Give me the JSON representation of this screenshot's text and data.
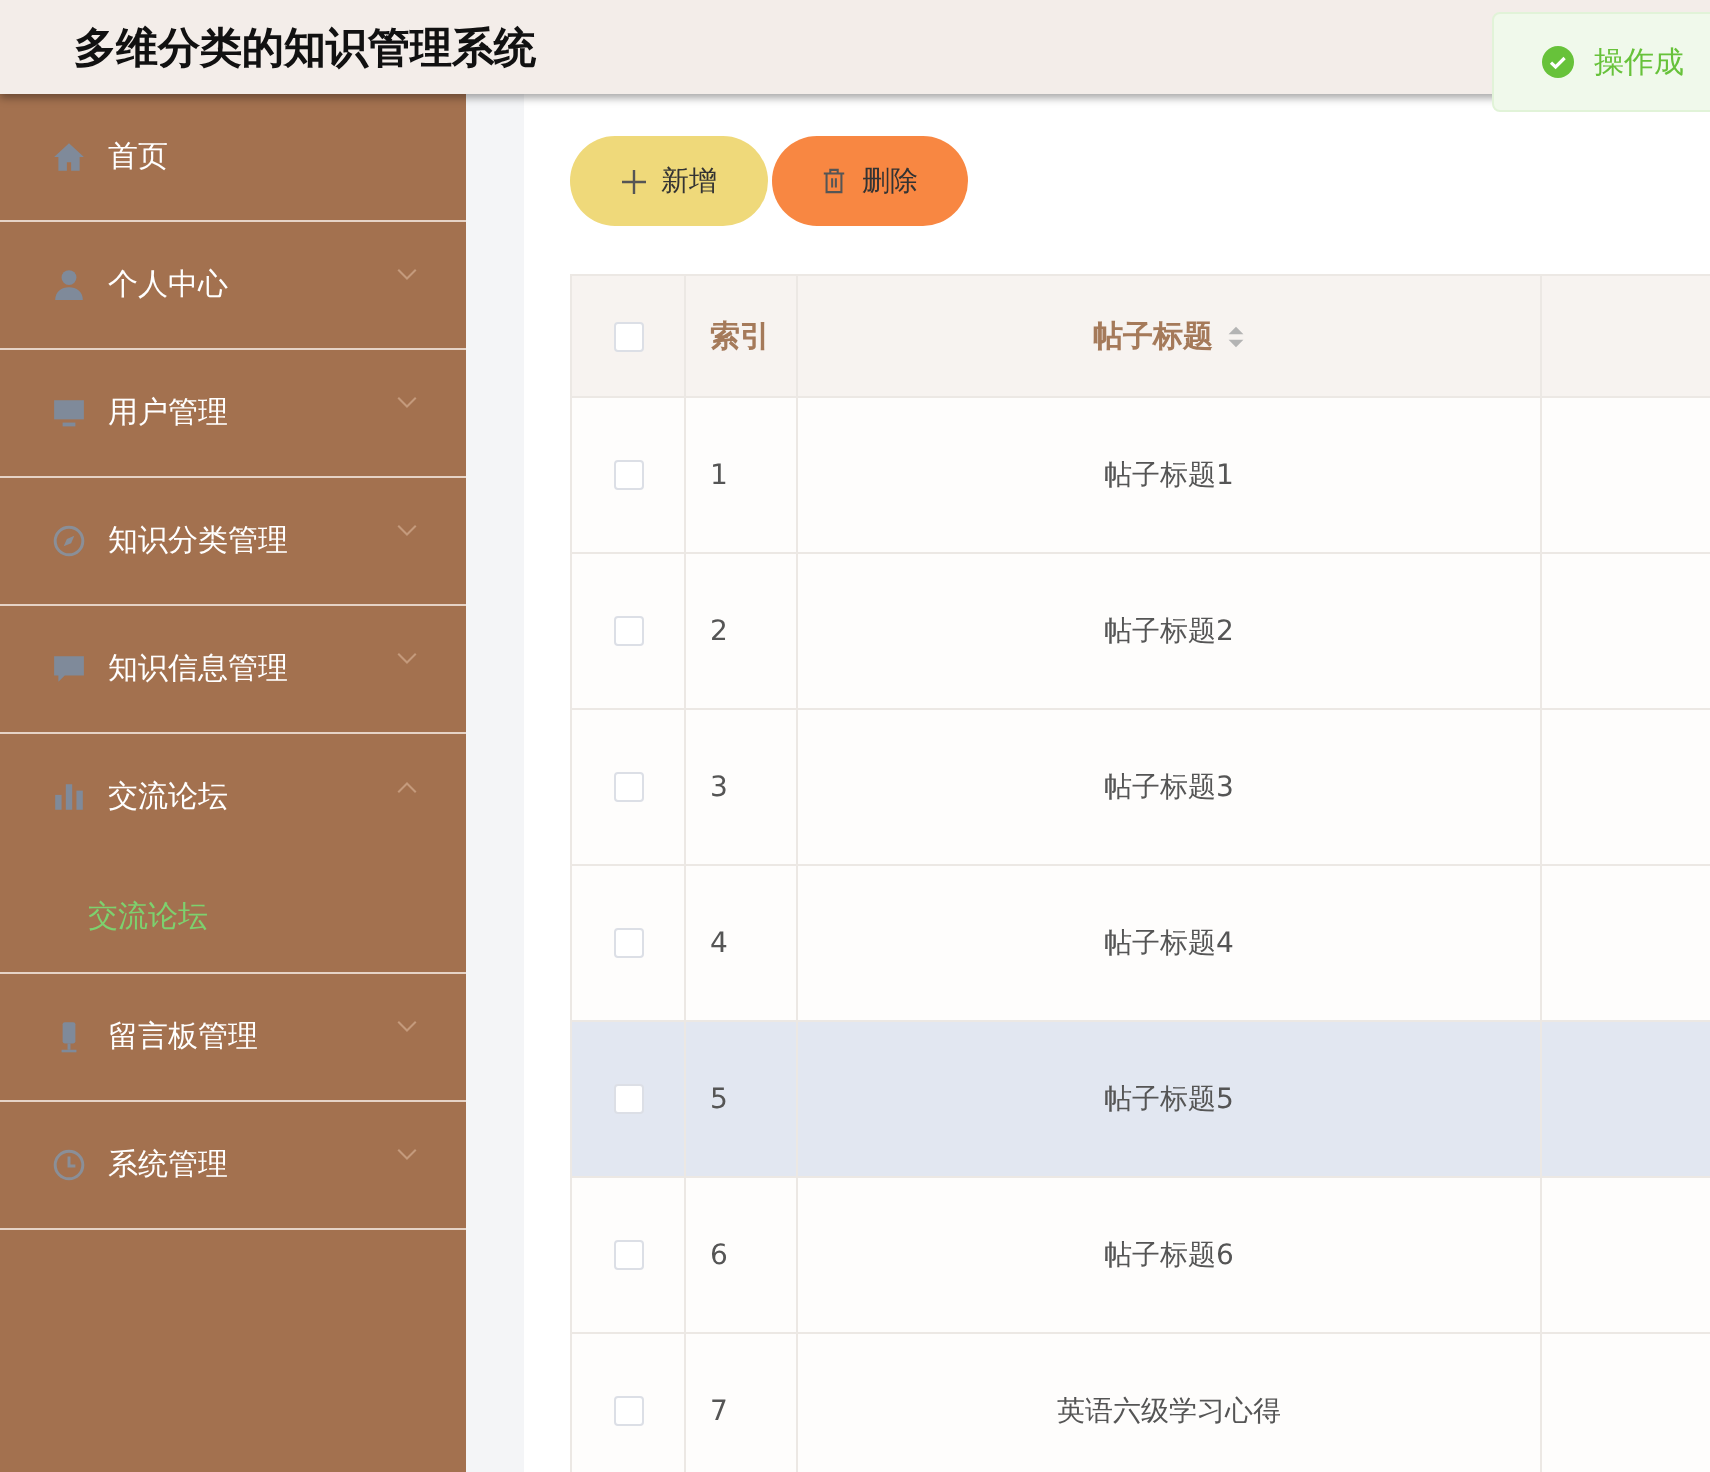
{
  "header": {
    "title": "多维分类的知识管理系统"
  },
  "toast": {
    "kind": "success",
    "text": "操作成"
  },
  "sidebar": {
    "items": [
      {
        "label": "首页"
      },
      {
        "label": "个人中心",
        "expandable": true,
        "expanded": false
      },
      {
        "label": "用户管理",
        "expandable": true,
        "expanded": false
      },
      {
        "label": "知识分类管理",
        "expandable": true,
        "expanded": false
      },
      {
        "label": "知识信息管理",
        "expandable": true,
        "expanded": false
      },
      {
        "label": "交流论坛",
        "expandable": true,
        "expanded": true,
        "children": [
          {
            "label": "交流论坛",
            "selected": true
          }
        ]
      },
      {
        "label": "留言板管理",
        "expandable": true,
        "expanded": false
      },
      {
        "label": "系统管理",
        "expandable": true,
        "expanded": false
      }
    ]
  },
  "toolbar": {
    "buttons": [
      {
        "kind": "add",
        "label": "新增"
      },
      {
        "kind": "delete",
        "label": "删除"
      }
    ]
  },
  "table": {
    "all_checked": false,
    "columns": [
      {
        "label": "索引",
        "sortable": false
      },
      {
        "label": "帖子标题",
        "sortable": true
      }
    ],
    "rows": [
      {
        "index": "1",
        "title": "帖子标题1",
        "checked": false,
        "highlighted": false
      },
      {
        "index": "2",
        "title": "帖子标题2",
        "checked": false,
        "highlighted": false
      },
      {
        "index": "3",
        "title": "帖子标题3",
        "checked": false,
        "highlighted": false
      },
      {
        "index": "4",
        "title": "帖子标题4",
        "checked": false,
        "highlighted": false
      },
      {
        "index": "5",
        "title": "帖子标题5",
        "checked": false,
        "highlighted": true
      },
      {
        "index": "6",
        "title": "帖子标题6",
        "checked": false,
        "highlighted": false
      },
      {
        "index": "7",
        "title": "英语六级学习心得",
        "checked": false,
        "highlighted": false
      }
    ]
  }
}
